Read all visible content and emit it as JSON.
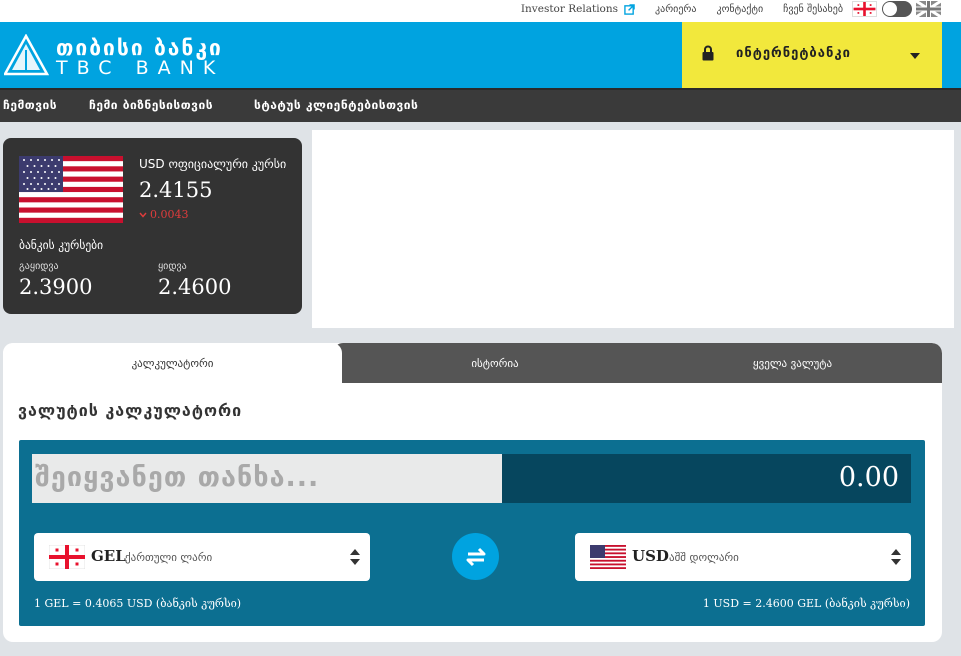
{
  "topbar": {
    "investor_relations": "Investor Relations",
    "career": "კარიერა",
    "contact": "კონტაქტი",
    "about": "ჩვენ შესახებ"
  },
  "header": {
    "logo_line1": "თიბისი ბანკი",
    "logo_line2": "TBC BANK",
    "internet_bank_label": "ინტერნეტბანკი",
    "brand_color": "#00a3e0",
    "ibank_color": "#f2e83c"
  },
  "nav": {
    "items": [
      {
        "label": "ჩემთვის"
      },
      {
        "label": "ჩემი ბიზნესისთვის"
      },
      {
        "label": "სტატუს კლიენტებისთვის"
      }
    ]
  },
  "rate_card": {
    "title": "USD ოფიციალური კურსი",
    "official_rate": "2.4155",
    "change": "0.0043",
    "change_direction": "down",
    "bank_rates_label": "ბანკის კურსები",
    "buy_label": "გაყიდვა",
    "sell_label": "ყიდვა",
    "buy_value": "2.3900",
    "sell_value": "2.4600"
  },
  "calculator": {
    "tabs": [
      {
        "label": "კალკულატორი",
        "active": true
      },
      {
        "label": "ისტორია",
        "active": false
      },
      {
        "label": "ყველა ვალუტა",
        "active": false
      }
    ],
    "title": "ვალუტის კალკულატორი",
    "amount_placeholder": "შეიყვანეთ თანხა...",
    "amount_value": "0.00",
    "from": {
      "code": "GEL",
      "name": "ქართული ლარი",
      "flag": "georgia-flag-icon"
    },
    "to": {
      "code": "USD",
      "name": "აშშ დოლარი",
      "flag": "usa-flag-icon"
    },
    "rate_from_text": "1 GEL = 0.4065 USD (ბანკის კურსი)",
    "rate_to_text": "1 USD = 2.4600 GEL (ბანკის კურსი)",
    "panel_color": "#0c6f91"
  }
}
